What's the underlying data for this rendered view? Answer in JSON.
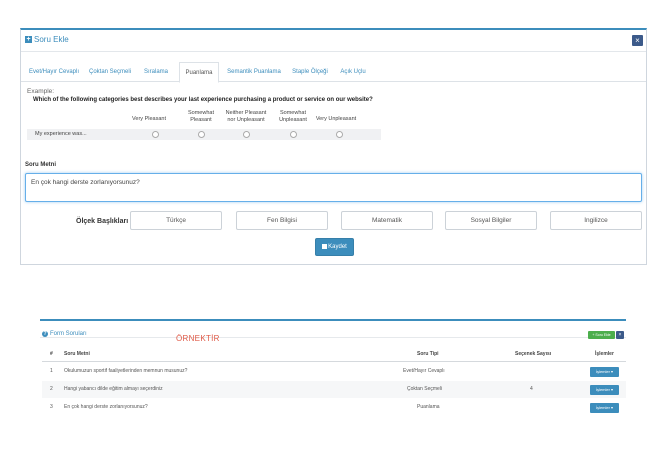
{
  "modal": {
    "title": "Soru Ekle",
    "close_label": "×",
    "tabs": [
      {
        "label": "Evet/Hayır Cevaplı"
      },
      {
        "label": "Çoktan Seçmeli"
      },
      {
        "label": "Sıralama"
      },
      {
        "label": "Puanlama"
      },
      {
        "label": "Semantik Puanlama"
      },
      {
        "label": "Staple Ölçeği"
      },
      {
        "label": "Açık Uçlu"
      }
    ],
    "active_tab": "Puanlama",
    "example": {
      "label": "Example:",
      "question": "Which of the following categories best describes your last experience purchasing a product or service on our website?",
      "scale": [
        "Very Pleasant",
        "Somewhat Pleasant",
        "Neither Pleasant nor Unpleasant",
        "Somewhat Unpleasant",
        "Very Unpleasant"
      ],
      "row_label": "My experience was..."
    },
    "soru_metni_label": "Soru Metni",
    "soru_metni_value": "En çok hangi derste zorlanıyorsunuz?",
    "olcek_label": "Ölçek Başlıkları",
    "olcek_values": [
      "Türkçe",
      "Fen Bilgisi",
      "Matematik",
      "Sosyal Bilgiler",
      "İngilizce"
    ],
    "save_label": "Kaydet"
  },
  "list": {
    "title": "Form Soruları",
    "annotation": "ÖRNEKTİR",
    "add_label": "+ Soru Ekle",
    "minimize_label": "×",
    "columns": [
      "#",
      "Soru Metni",
      "Soru Tipi",
      "Seçenek Sayısı",
      "İşlemler"
    ],
    "rows": [
      {
        "num": "1",
        "text": "Okulumuzun sportif faaliyetlerinden memnun musunuz?",
        "type": "Evet/Hayır Cevaplı",
        "count": "",
        "action": "İşlemler ▾"
      },
      {
        "num": "2",
        "text": "Hangi yabancı dilde eğitim almayı seçerdiniz",
        "type": "Çoktan Seçmeli",
        "count": "4",
        "action": "İşlemler ▾"
      },
      {
        "num": "3",
        "text": "En çok hangi derste zorlanıyorsunuz?",
        "type": "Puanlama",
        "count": "",
        "action": "İşlemler ▾"
      }
    ]
  },
  "colors": {
    "accent": "#3c8dbc",
    "success": "#4cae4c",
    "annotation": "#e05a47"
  }
}
